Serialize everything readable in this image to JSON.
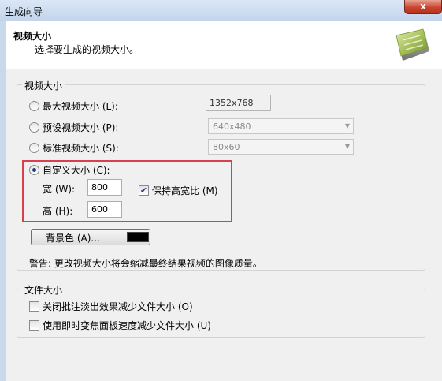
{
  "window": {
    "title": "生成向导",
    "close_label": "x"
  },
  "header": {
    "title": "视频大小",
    "subtitle": "选择要生成的视频大小。",
    "logo_icon": "wizard-logo-icon"
  },
  "video_size_group": {
    "label": "视频大小",
    "options": [
      {
        "label": "最大视频大小 (L):",
        "value": "1352x768",
        "checked": false
      },
      {
        "label": "预设视频大小 (P):",
        "value": "640x480",
        "checked": false
      },
      {
        "label": "标准视频大小 (S):",
        "value": "80x60",
        "checked": false
      },
      {
        "label": "自定义大小 (C):",
        "checked": true
      }
    ],
    "custom": {
      "width_label": "宽 (W):",
      "width_value": "800",
      "height_label": "高 (H):",
      "height_value": "600",
      "keep_ratio_label": "保持高宽比 (M)",
      "keep_ratio_checked": true
    },
    "background_button": {
      "label": "背景色 (A)...",
      "color": "#000000"
    },
    "warning": "警告: 更改视频大小将会缩减最终结果视频的图像质量。"
  },
  "file_size_group": {
    "label": "文件大小",
    "options": [
      {
        "label": "关闭批注淡出效果减少文件大小 (O)",
        "checked": false
      },
      {
        "label": "使用即时变焦面板速度减少文件大小 (U)",
        "checked": false
      }
    ]
  },
  "colors": {
    "highlight_border": "#d8414b",
    "titlebar": "#c3d5ec"
  }
}
